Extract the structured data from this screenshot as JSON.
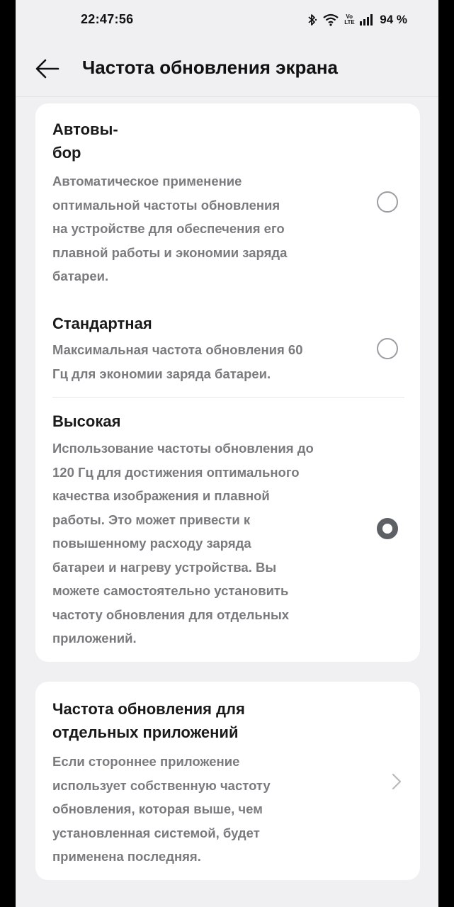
{
  "status_bar": {
    "time": "22:47:56",
    "volte": "Vo\nLTE",
    "battery": "94 %",
    "icons": [
      "bluetooth-icon",
      "wifi-icon",
      "volte-icon",
      "signal-icon"
    ]
  },
  "header": {
    "title": "Частота обновления экрана",
    "back_icon": "arrow-left-icon"
  },
  "refresh_rate_options": [
    {
      "title_lines": [
        "Автовы-",
        "бор"
      ],
      "description_lines": [
        "Автоматическое применение",
        "оптимальной частоты обновления",
        "на устройстве для обеспечения его",
        "плавной работы и экономии заряда",
        "батареи."
      ],
      "selected": false
    },
    {
      "title_lines": [
        "Стандартная"
      ],
      "description_lines": [
        "Максимальная частота обновления 60",
        "Гц для экономии заряда батареи."
      ],
      "selected": false
    },
    {
      "title_lines": [
        "Высокая"
      ],
      "description_lines": [
        "Использование частоты обновления до",
        "120 Гц для достижения оптимального",
        "качества изображения и плавной",
        "работы. Это может привести к",
        "повышенному расходу заряда",
        "батареи и нагреву устройства. Вы",
        "можете самостоятельно установить",
        "частоту обновления для отдельных",
        "приложений."
      ],
      "selected": true
    }
  ],
  "per_app": {
    "title_lines": [
      "Частота обновления для",
      "отдельных приложений"
    ],
    "description_lines": [
      "Если стороннее приложение",
      "использует собственную частоту",
      "обновления, которая выше, чем",
      "установленная системой, будет",
      "применена последняя."
    ],
    "chevron_icon": "chevron-right-icon"
  },
  "colors": {
    "background": "#f0f0f2",
    "card": "#ffffff",
    "title_text": "#1a1a1a",
    "description_text": "#7b7b7f",
    "radio_checked": "#5d6166"
  }
}
